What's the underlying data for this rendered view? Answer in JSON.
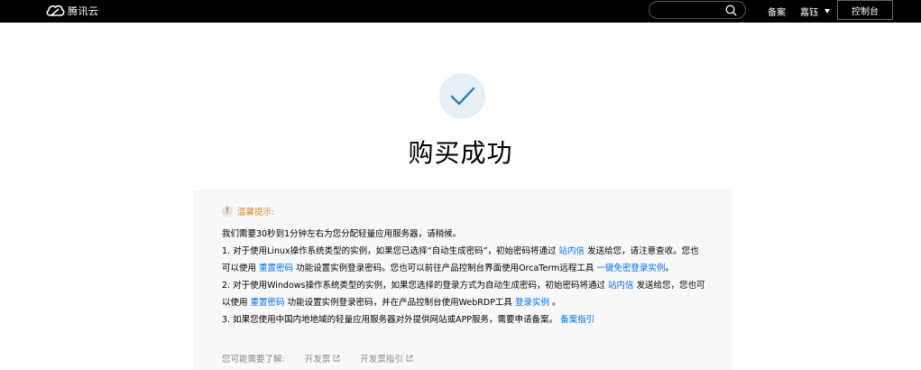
{
  "header": {
    "logo_text": "腾讯云",
    "search": {
      "placeholder": ""
    },
    "nav": {
      "beian": "备案",
      "user": "嘉钰",
      "console": "控制台"
    }
  },
  "main": {
    "title": "购买成功",
    "tip_label": "温馨提示:",
    "tip_icon_char": "!",
    "lines": {
      "l0": "我们需要30秒到1分钟左右为您分配轻量应用服务器，请稍候。",
      "l1_a": "1. 对于使用Linux操作系统类型的实例，如果您已选择“自动生成密码”，初始密码将通过 ",
      "l1_link": "站内信",
      "l1_b": " 发送给您，请注意查收。您也",
      "l2_a": "可以使用 ",
      "l2_link": "重置密码",
      "l2_b": " 功能设置实例登录密码。您也可以前往产品控制台界面使用OrcaTerm远程工具 ",
      "l2_link2": "一键免密登录实例",
      "l2_c": "。",
      "l3_a": "2. 对于使用Windows操作系统类型的实例，如果您选择的登录方式为自动生成密码，初始密码将通过 ",
      "l3_link": "站内信",
      "l3_b": " 发送给您，您也可",
      "l4_a": "以使用 ",
      "l4_link": "重置密码",
      "l4_b": " 功能设置实例登录密码，并在产品控制台使用WebRDP工具 ",
      "l4_link2": "登录实例",
      "l4_c": " 。",
      "l5_a": "3. 如果您使用中国内地地域的轻量应用服务器对外提供网站或APP服务，需要申请备案。 ",
      "l5_link": "备案指引"
    },
    "more": {
      "label": "您可能需要了解:",
      "link1": "开发票",
      "link2": "开发票指引"
    }
  },
  "colors": {
    "topbar": "#000000",
    "link": "#006eff",
    "tip": "#e28b26",
    "panel": "#f7f8fa",
    "check": "#2f7fbf"
  },
  "icons": [
    "cloud-logo-icon",
    "search-icon",
    "caret-down-icon",
    "check-icon",
    "warning-icon",
    "external-link-icon"
  ]
}
